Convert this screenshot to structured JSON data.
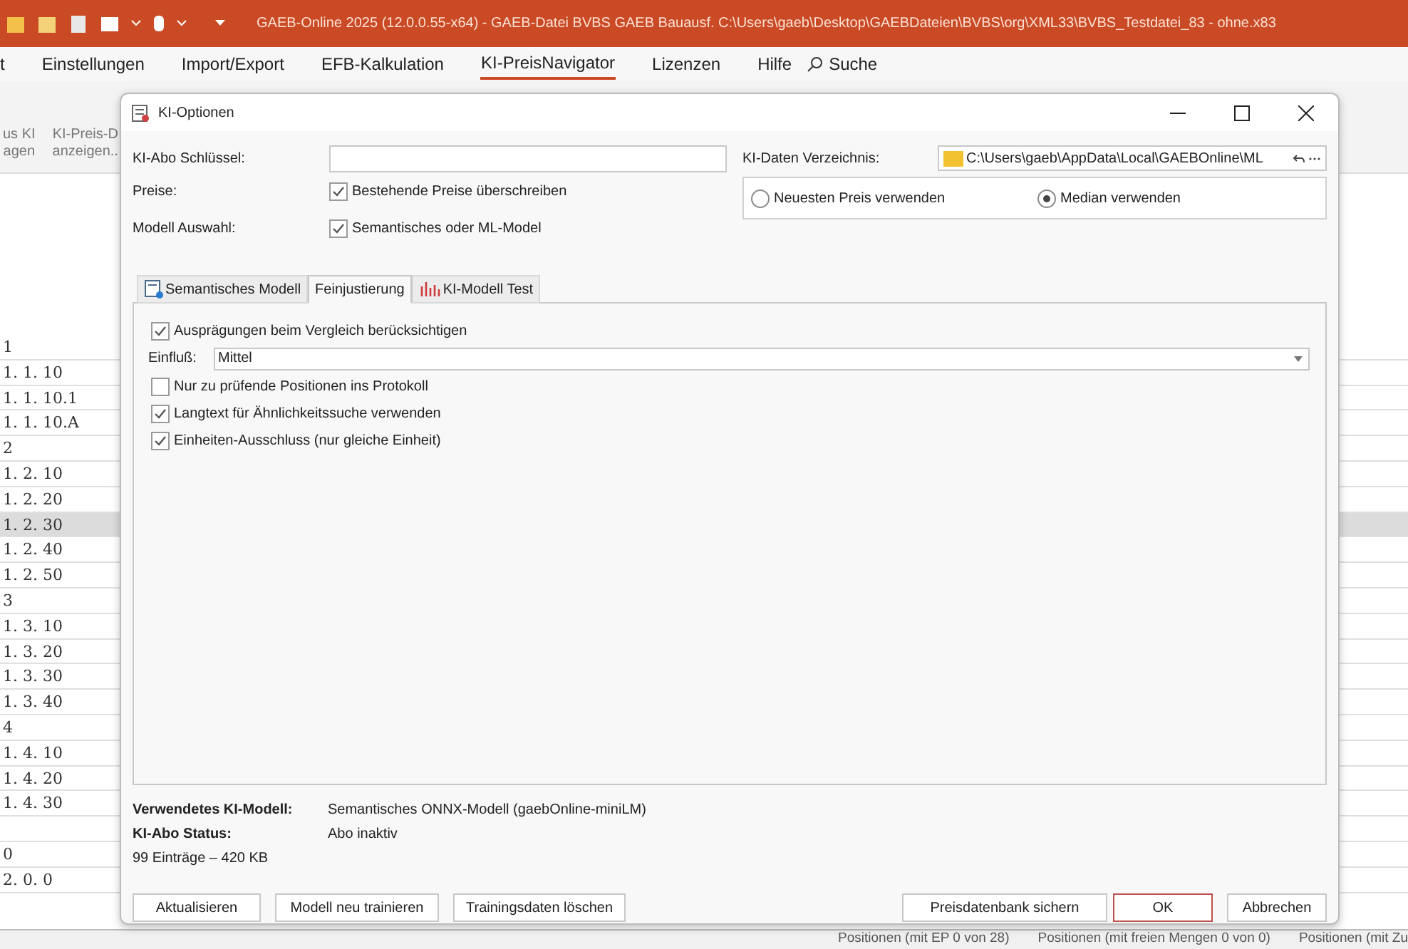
{
  "app": {
    "title": "GAEB-Online 2025 (12.0.0.55-x64) - GAEB-Datei  BVBS GAEB Bauausf. C:\\Users\\gaeb\\Desktop\\GAEBDateien\\BVBS\\org\\XML33\\BVBS_Testdatei_83 - ohne.x83",
    "menu": [
      {
        "label": "t",
        "selected": false
      },
      {
        "label": "Einstellungen",
        "selected": false
      },
      {
        "label": "Import/Export",
        "selected": false
      },
      {
        "label": "EFB-Kalkulation",
        "selected": false
      },
      {
        "label": "KI-PreisNavigator",
        "selected": true
      },
      {
        "label": "Lizenzen",
        "selected": false
      },
      {
        "label": "Hilfe",
        "selected": false
      }
    ],
    "search": "Suche",
    "ribbon": [
      {
        "lines": [
          "us KI",
          "agen"
        ]
      },
      {
        "lines": [
          "KI-Preis-D",
          "anzeigen.."
        ]
      }
    ],
    "rows": [
      {
        "text": "1",
        "selected": false
      },
      {
        "text": "1.  1.  10",
        "selected": false
      },
      {
        "text": "1.  1.  10.1",
        "selected": false
      },
      {
        "text": "1.  1.  10.A",
        "selected": false
      },
      {
        "text": "2",
        "selected": false
      },
      {
        "text": "1.  2.  10",
        "selected": false
      },
      {
        "text": "1.  2.  20",
        "selected": false
      },
      {
        "text": "1.  2.  30",
        "selected": true
      },
      {
        "text": "1.  2.  40",
        "selected": false
      },
      {
        "text": "1.  2.  50",
        "selected": false
      },
      {
        "text": "3",
        "selected": false
      },
      {
        "text": "1.  3.  10",
        "selected": false
      },
      {
        "text": "1.  3.  20",
        "selected": false
      },
      {
        "text": "1.  3.  30",
        "selected": false
      },
      {
        "text": "1.  3.  40",
        "selected": false
      },
      {
        "text": "4",
        "selected": false
      },
      {
        "text": "1.  4.  10",
        "selected": false
      },
      {
        "text": "1.  4.  20",
        "selected": false
      },
      {
        "text": "1.  4.  30",
        "selected": false
      },
      {
        "text": "",
        "selected": false
      },
      {
        "text": "0",
        "selected": false
      },
      {
        "text": "2.  0.  0",
        "selected": false
      }
    ],
    "status_bar": [
      "Positionen (mit EP 0 von 28)",
      "Positionen (mit freien Mengen 0 von 0)",
      "Positionen (mit Zu"
    ]
  },
  "dialog": {
    "title": "KI-Optionen",
    "abo_key": {
      "label": "KI-Abo Schlüssel:"
    },
    "fields": [
      {
        "label": "Preise:",
        "checkbox": "Bestehende Preise überschreiben",
        "checked": true
      },
      {
        "label": "Modell Auswahl:",
        "checkbox": "Semantisches oder ML-Model",
        "checked": true
      }
    ],
    "data_dir": {
      "label": "KI-Daten Verzeichnis:",
      "value": "C:\\Users\\gaeb\\AppData\\Local\\GAEBOnline\\ML"
    },
    "radios": [
      {
        "label": "Neuesten Preis verwenden",
        "selected": false
      },
      {
        "label": "Median verwenden",
        "selected": true
      }
    ],
    "tabs": [
      {
        "label": "Semantisches Modell",
        "selected": false,
        "kind": "model"
      },
      {
        "label": "Feinjustierung",
        "selected": true,
        "kind": "plain"
      },
      {
        "label": "KI-Modell Test",
        "selected": false,
        "kind": "chart"
      }
    ],
    "options": [
      {
        "kind": "checkbox",
        "label": "Ausprägungen beim Vergleich berücksichtigen",
        "checked": true
      },
      {
        "kind": "combo",
        "label": "Einfluß:",
        "value": "Mittel"
      },
      {
        "kind": "checkbox",
        "label": "Nur zu prüfende Positionen ins Protokoll",
        "checked": false
      },
      {
        "kind": "checkbox",
        "label": "Langtext für Ähnlichkeitssuche verwenden",
        "checked": true
      },
      {
        "kind": "checkbox",
        "label": "Einheiten-Ausschluss (nur gleiche Einheit)",
        "checked": true
      }
    ],
    "info": [
      {
        "label": "Verwendetes KI-Modell:",
        "value": "Semantisches ONNX-Modell (gaebOnline-miniLM)"
      },
      {
        "label": "KI-Abo Status:",
        "value": "Abo inaktiv"
      }
    ],
    "size": "99 Einträge – 420 KB",
    "buttons_left": [
      "Aktualisieren",
      "Modell neu trainieren",
      "Trainingsdaten löschen"
    ],
    "buttons_right": [
      {
        "label": "Preisdatenbank sichern",
        "default": false
      },
      {
        "label": "OK",
        "default": true
      },
      {
        "label": "Abbrechen",
        "default": false
      }
    ]
  }
}
